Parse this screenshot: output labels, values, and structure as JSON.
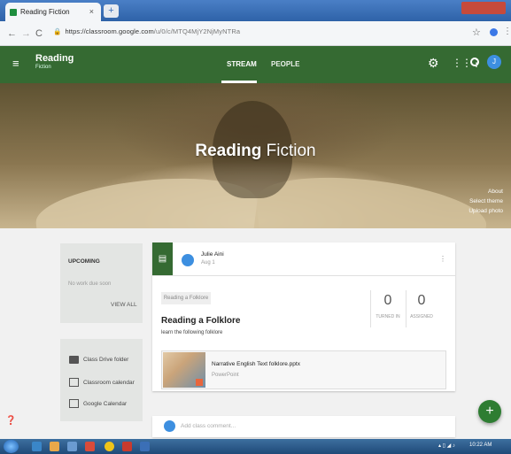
{
  "browser": {
    "tab_title": "Reading Fiction",
    "tab_close": "×",
    "new_tab": "+",
    "back": "←",
    "forward": "→",
    "reload": "C",
    "url_host": "https://classroom.google.com",
    "url_path": "/u/0/c/MTQ4MjY2NjMyNTRa",
    "star": "☆",
    "menu": "⋮"
  },
  "appbar": {
    "menu_icon": "≡",
    "class_name": "Reading",
    "section": "Fiction",
    "tabs": [
      {
        "label": "STREAM",
        "active": true
      },
      {
        "label": "PEOPLE",
        "active": false
      }
    ],
    "user_initial": "J"
  },
  "banner": {
    "title_bold": "Reading",
    "title_rest": " Fiction",
    "links": [
      "About",
      "Select theme",
      "Upload photo"
    ]
  },
  "upcoming": {
    "title": "UPCOMING",
    "empty_text": "No work due soon",
    "view_all": "VIEW ALL"
  },
  "quick_links": [
    {
      "label": "Class Drive folder",
      "icon": "folder-icon"
    },
    {
      "label": "Classroom calendar",
      "icon": "calendar-icon"
    },
    {
      "label": "Google Calendar",
      "icon": "external-link-icon"
    }
  ],
  "post": {
    "author": "Julie Aini",
    "date": "Aug 1",
    "topic_chip": "Reading a Folklore",
    "title": "Reading a Folklore",
    "description": "learn the following folklore",
    "turned_in": {
      "value": "0",
      "label": "TURNED IN"
    },
    "assigned": {
      "value": "0",
      "label": "ASSIGNED"
    },
    "attachment": {
      "name": "Narrative English Text folklore.pptx",
      "type": "PowerPoint"
    },
    "comment_placeholder": "Add class comment..."
  },
  "taskbar": {
    "clock": "10:22 AM"
  },
  "colors": {
    "theme_green": "#356a32",
    "fab_green": "#2e7d32",
    "avatar_blue": "#3d8fe0"
  }
}
